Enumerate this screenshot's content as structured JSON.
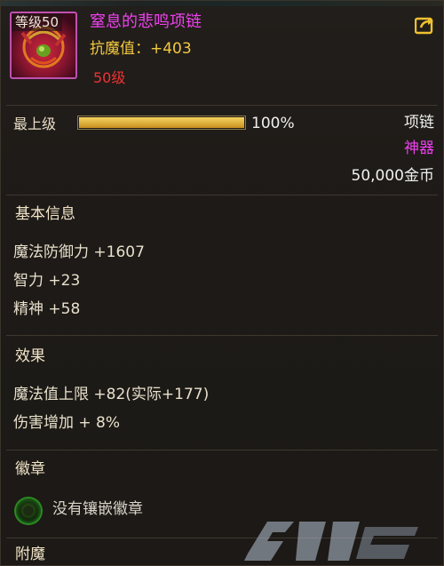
{
  "item": {
    "level_badge": "等级50",
    "name": "窒息的悲鸣项链",
    "stat": "抗魔值：+403",
    "required_level": "50级"
  },
  "upgrade": {
    "label": "最上级",
    "progress_percent": 100,
    "progress_text": "100%"
  },
  "meta": {
    "slot": "项链",
    "rarity": "神器",
    "price": "50,000金币"
  },
  "sections": {
    "basic_title": "基本信息",
    "basic_attrs": [
      "魔法防御力 +1607",
      "智力 +23",
      "精神 +58"
    ],
    "effect_title": "效果",
    "effect_attrs": [
      "魔法值上限 +82(实际+177)",
      "伤害增加 + 8%"
    ],
    "emblem_title": "徽章",
    "emblem_empty": "没有镶嵌徽章",
    "enchant_title": "附魔"
  },
  "colors": {
    "name": "#ee40ee",
    "stat": "#f2c940",
    "required_level": "#ee3333",
    "rarity": "#ee40ee",
    "progress": "#e8b830"
  },
  "icons": {
    "share": "share-arrow-icon",
    "emblem_slot": "empty-emblem-orb-icon"
  }
}
